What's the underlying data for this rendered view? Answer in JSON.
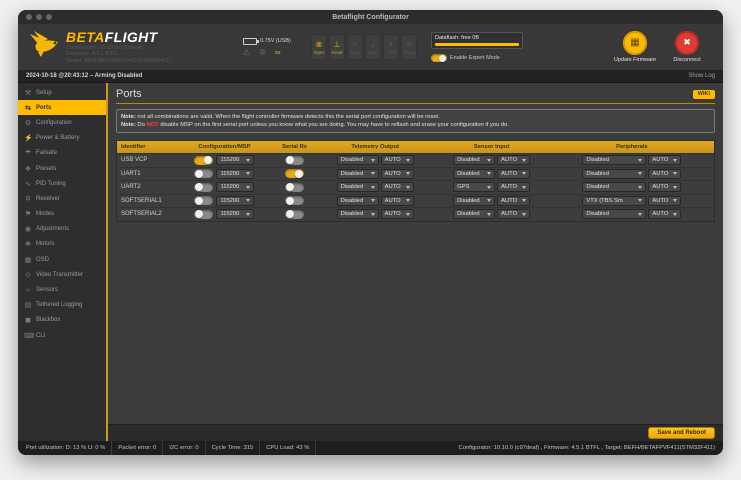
{
  "window": {
    "title": "Betaflight Configurator"
  },
  "header": {
    "logo_beta": "BETA",
    "logo_flight": "FLIGHT",
    "info_lines": {
      "configurator": "Configurator: 10.10.0 (c97deaf)",
      "firmware": "Firmware: 4.5.1 BTFL",
      "target": "Target: BEFH/BETAFPVF411(STM32F411)"
    },
    "battery_voltage": "0.75V (USB)",
    "sensors": [
      {
        "label": "Gyro",
        "icon": "gyro-icon",
        "glyph": "⊗",
        "active": true
      },
      {
        "label": "Accel",
        "icon": "accel-icon",
        "glyph": "⊥",
        "active": true
      },
      {
        "label": "Mag",
        "icon": "mag-icon",
        "glyph": "⌖",
        "active": false
      },
      {
        "label": "Baro",
        "icon": "baro-icon",
        "glyph": "◒",
        "active": false
      },
      {
        "label": "GPS",
        "icon": "gps-icon",
        "glyph": "✦",
        "active": false
      },
      {
        "label": "Sonar",
        "icon": "sonar-icon",
        "glyph": "≋",
        "active": false
      }
    ],
    "dataflash_label": "Dataflash: free 0B",
    "expert_mode_label": "Enable Expert Mode",
    "expert_mode_on": true,
    "update_firmware_label": "Update Firmware",
    "disconnect_label": "Disconnect"
  },
  "logbar": {
    "status": "2024-10-18 @20:43:12 – Arming Disabled",
    "show_log": "Show Log"
  },
  "sidebar": {
    "items": [
      {
        "label": "Setup",
        "glyph": "⚒",
        "active": false
      },
      {
        "label": "Ports",
        "glyph": "⇆",
        "active": true
      },
      {
        "label": "Configuration",
        "glyph": "⚙",
        "active": false
      },
      {
        "label": "Power & Battery",
        "glyph": "⚡",
        "active": false
      },
      {
        "label": "Failsafe",
        "glyph": "☂",
        "active": false
      },
      {
        "label": "Presets",
        "glyph": "❖",
        "active": false
      },
      {
        "label": "PID Tuning",
        "glyph": "∿",
        "active": false
      },
      {
        "label": "Receiver",
        "glyph": "ψ",
        "active": false
      },
      {
        "label": "Modes",
        "glyph": "⚑",
        "active": false
      },
      {
        "label": "Adjustments",
        "glyph": "◉",
        "active": false
      },
      {
        "label": "Motors",
        "glyph": "❋",
        "active": false
      },
      {
        "label": "OSD",
        "glyph": "▦",
        "active": false
      },
      {
        "label": "Video Transmitter",
        "glyph": "⊙",
        "active": false
      },
      {
        "label": "Sensors",
        "glyph": "≈",
        "active": false
      },
      {
        "label": "Tethered Logging",
        "glyph": "▤",
        "active": false
      },
      {
        "label": "Blackbox",
        "glyph": "◼",
        "active": false
      },
      {
        "label": "CLI",
        "glyph": "⌨",
        "active": false
      }
    ]
  },
  "content": {
    "title": "Ports",
    "wiki_label": "WIKI",
    "note1_prefix": "Note:",
    "note1_text": " not all combinations are valid. When the flight controller firmware detects this the serial port configuration will be reset.",
    "note2_prefix": "Note:",
    "note2_pre": " Do ",
    "note2_warn": "NOT",
    "note2_post": " disable MSP on the first serial port unless you know what you are doing. You may have to reflash and erase your configuration if you do.",
    "table": {
      "headers": [
        "Identifier",
        "Configuration/MSP",
        "Serial Rx",
        "Telemetry Output",
        "Sensor Input",
        "Peripherals"
      ],
      "rows": [
        {
          "identifier": "USB VCP",
          "msp_on": true,
          "baud": "115200",
          "serial_rx_on": false,
          "telemetry": "Disabled",
          "telemetry_baud": "AUTO",
          "sensor": "Disabled",
          "sensor_baud": "AUTO",
          "peripheral": "Disabled",
          "peripheral_baud": "AUTO"
        },
        {
          "identifier": "UART1",
          "msp_on": false,
          "baud": "115200",
          "serial_rx_on": true,
          "telemetry": "Disabled",
          "telemetry_baud": "AUTO",
          "sensor": "Disabled",
          "sensor_baud": "AUTO",
          "peripheral": "Disabled",
          "peripheral_baud": "AUTO"
        },
        {
          "identifier": "UART2",
          "msp_on": false,
          "baud": "115200",
          "serial_rx_on": false,
          "telemetry": "Disabled",
          "telemetry_baud": "AUTO",
          "sensor": "GPS",
          "sensor_baud": "AUTO",
          "peripheral": "Disabled",
          "peripheral_baud": "AUTO"
        },
        {
          "identifier": "SOFTSERIAL1",
          "msp_on": false,
          "baud": "115200",
          "serial_rx_on": false,
          "telemetry": "Disabled",
          "telemetry_baud": "AUTO",
          "sensor": "Disabled",
          "sensor_baud": "AUTO",
          "peripheral": "VTX (TBS Sm",
          "peripheral_baud": "AUTO"
        },
        {
          "identifier": "SOFTSERIAL2",
          "msp_on": false,
          "baud": "115200",
          "serial_rx_on": false,
          "telemetry": "Disabled",
          "telemetry_baud": "AUTO",
          "sensor": "Disabled",
          "sensor_baud": "AUTO",
          "peripheral": "Disabled",
          "peripheral_baud": "AUTO"
        }
      ]
    },
    "save_button": "Save and Reboot"
  },
  "footer": {
    "segments": [
      "Port utilization: D: 13 % U: 0 %",
      "Packet error: 0",
      "I2C error: 0",
      "Cycle Time: 315",
      "CPU Load: 43 %"
    ],
    "right": "Configurator: 10.10.0 (c97deaf) , Firmware: 4.5.1 BTFL , Target: BEFH/BETAFPVF411(STM32F411)"
  },
  "colors": {
    "accent": "#ffbb00",
    "table_header_gold": "#d3a018",
    "danger_red": "#e23b33",
    "warn_text": "#ff3b30"
  }
}
